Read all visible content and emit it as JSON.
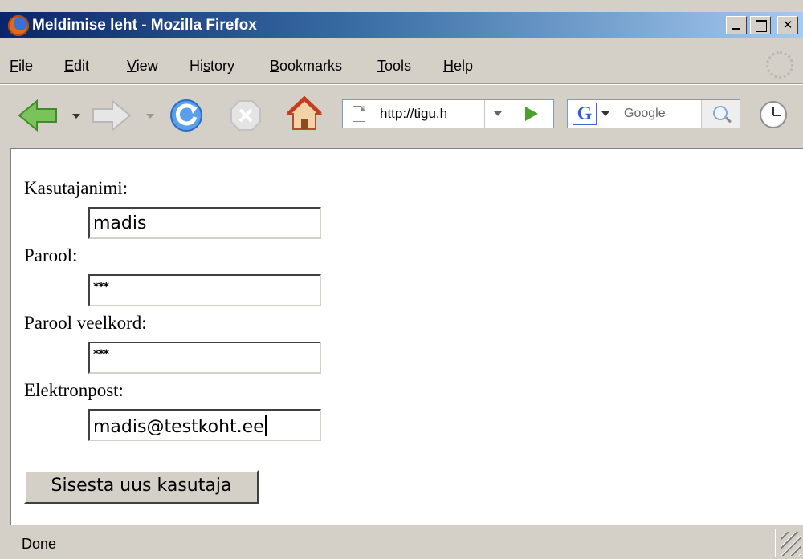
{
  "window": {
    "title": "Meldimise leht - Mozilla Firefox"
  },
  "menubar": {
    "items": [
      {
        "label": "File",
        "mnemonic": "F",
        "rest": "ile"
      },
      {
        "label": "Edit",
        "mnemonic": "E",
        "rest": "dit"
      },
      {
        "label": "View",
        "mnemonic": "V",
        "rest": "iew"
      },
      {
        "label": "History",
        "pre": "Hi",
        "mnemonic": "s",
        "rest": "tory"
      },
      {
        "label": "Bookmarks",
        "mnemonic": "B",
        "rest": "ookmarks"
      },
      {
        "label": "Tools",
        "mnemonic": "T",
        "rest": "ools"
      },
      {
        "label": "Help",
        "mnemonic": "H",
        "rest": "elp"
      }
    ]
  },
  "toolbar": {
    "url": "http://tigu.h",
    "search_placeholder": "Google",
    "search_engine_letter": "G"
  },
  "form": {
    "username_label": "Kasutajanimi:",
    "username_value": "madis",
    "password_label": "Parool:",
    "password_value": "***",
    "password_repeat_label": "Parool veelkord:",
    "password_repeat_value": "***",
    "email_label": "Elektronpost:",
    "email_value": "madis@testkoht.ee",
    "submit_label": "Sisesta uus kasutaja"
  },
  "statusbar": {
    "text": "Done"
  },
  "colors": {
    "titlebar_start": "#0a246a",
    "titlebar_end": "#a6caf0",
    "chrome": "#d4d0c8",
    "go_green": "#4aa02c"
  }
}
